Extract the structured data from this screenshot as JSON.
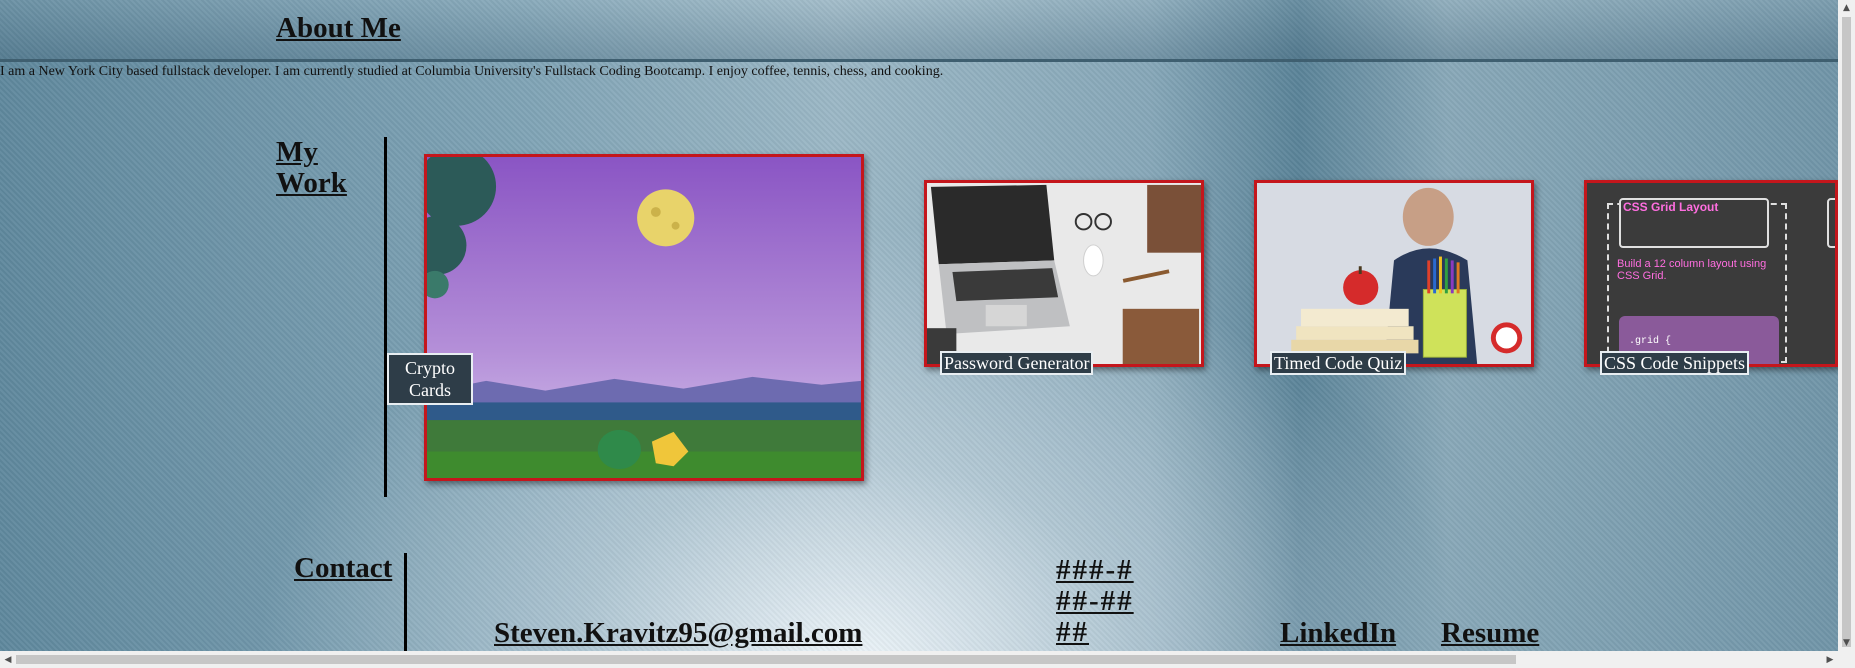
{
  "about": {
    "heading": "About Me",
    "text": "I am a New York City based fullstack developer. I am currently studied at Columbia University's Fullstack Coding Bootcamp. I enjoy coffee, tennis, chess, and cooking."
  },
  "work": {
    "heading": "My Work",
    "projects": [
      {
        "label": "Crypto Cards"
      },
      {
        "label": "Password Generator"
      },
      {
        "label": "Timed Code Quiz"
      },
      {
        "label": "CSS Code Snippets",
        "thumb_title": "CSS Grid Layout",
        "thumb_text": "Build a 12 column layout using CSS Grid.",
        "thumb_code": ".grid {"
      }
    ]
  },
  "contact": {
    "heading": "Contact",
    "email": "Steven.Kravitz95@gmail.com",
    "phone": "###-###-####",
    "linkedin": "LinkedIn",
    "resume": "Resume"
  },
  "colors": {
    "accent_border": "#c4161c",
    "label_bg": "#2e3d48"
  }
}
